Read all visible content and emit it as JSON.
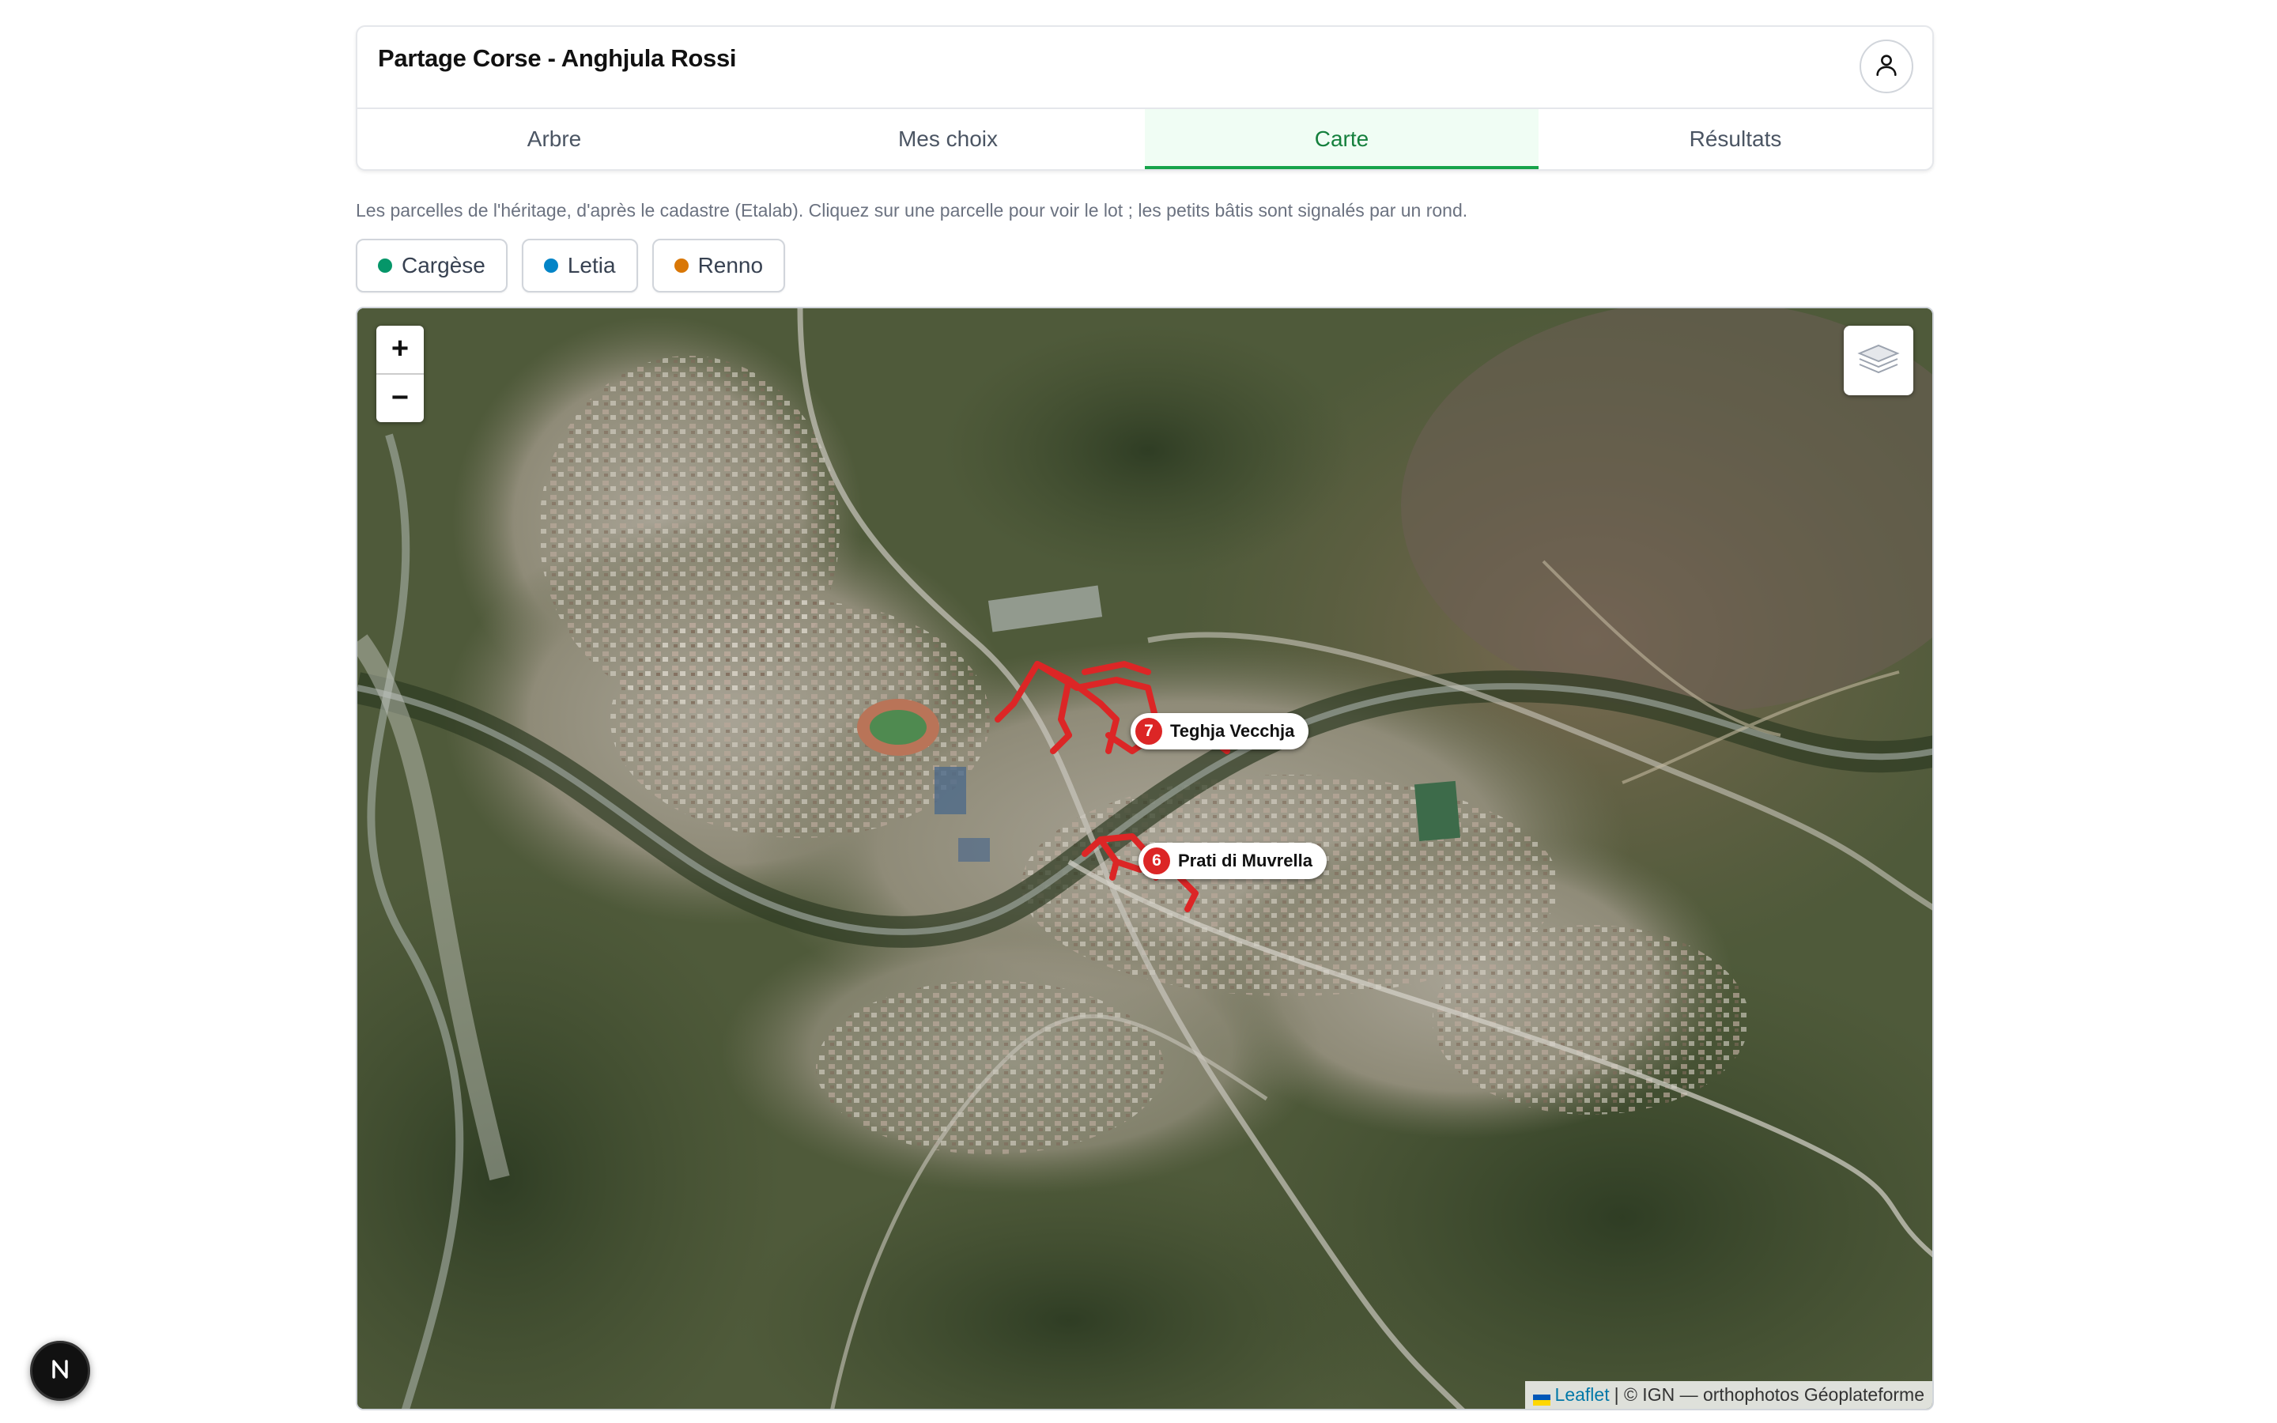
{
  "header": {
    "title": "Partage Corse - Anghjula Rossi",
    "user_icon": "user-icon"
  },
  "tabs": [
    {
      "label": "Arbre",
      "active": false
    },
    {
      "label": "Mes choix",
      "active": false
    },
    {
      "label": "Carte",
      "active": true
    },
    {
      "label": "Résultats",
      "active": false
    }
  ],
  "description": "Les parcelles de l'héritage, d'après le cadastre (Etalab). Cliquez sur une parcelle pour voir le lot ; les petits bâtis sont signalés par un rond.",
  "filters": [
    {
      "label": "Cargèse",
      "color": "#059669"
    },
    {
      "label": "Letia",
      "color": "#0284c7"
    },
    {
      "label": "Renno",
      "color": "#d97706"
    }
  ],
  "map": {
    "zoom_in": "+",
    "zoom_out": "−",
    "layers_icon": "layers-icon",
    "markers": [
      {
        "number": "7",
        "label": "Teghja Vecchja"
      },
      {
        "number": "6",
        "label": "Prati di Muvrella"
      }
    ],
    "attribution": {
      "link": "Leaflet",
      "text": "| © IGN — orthophotos Géoplateforme"
    },
    "parcel_color": "#dc2626"
  },
  "dev_badge": {
    "label": "N",
    "icon": "nextjs-icon"
  }
}
